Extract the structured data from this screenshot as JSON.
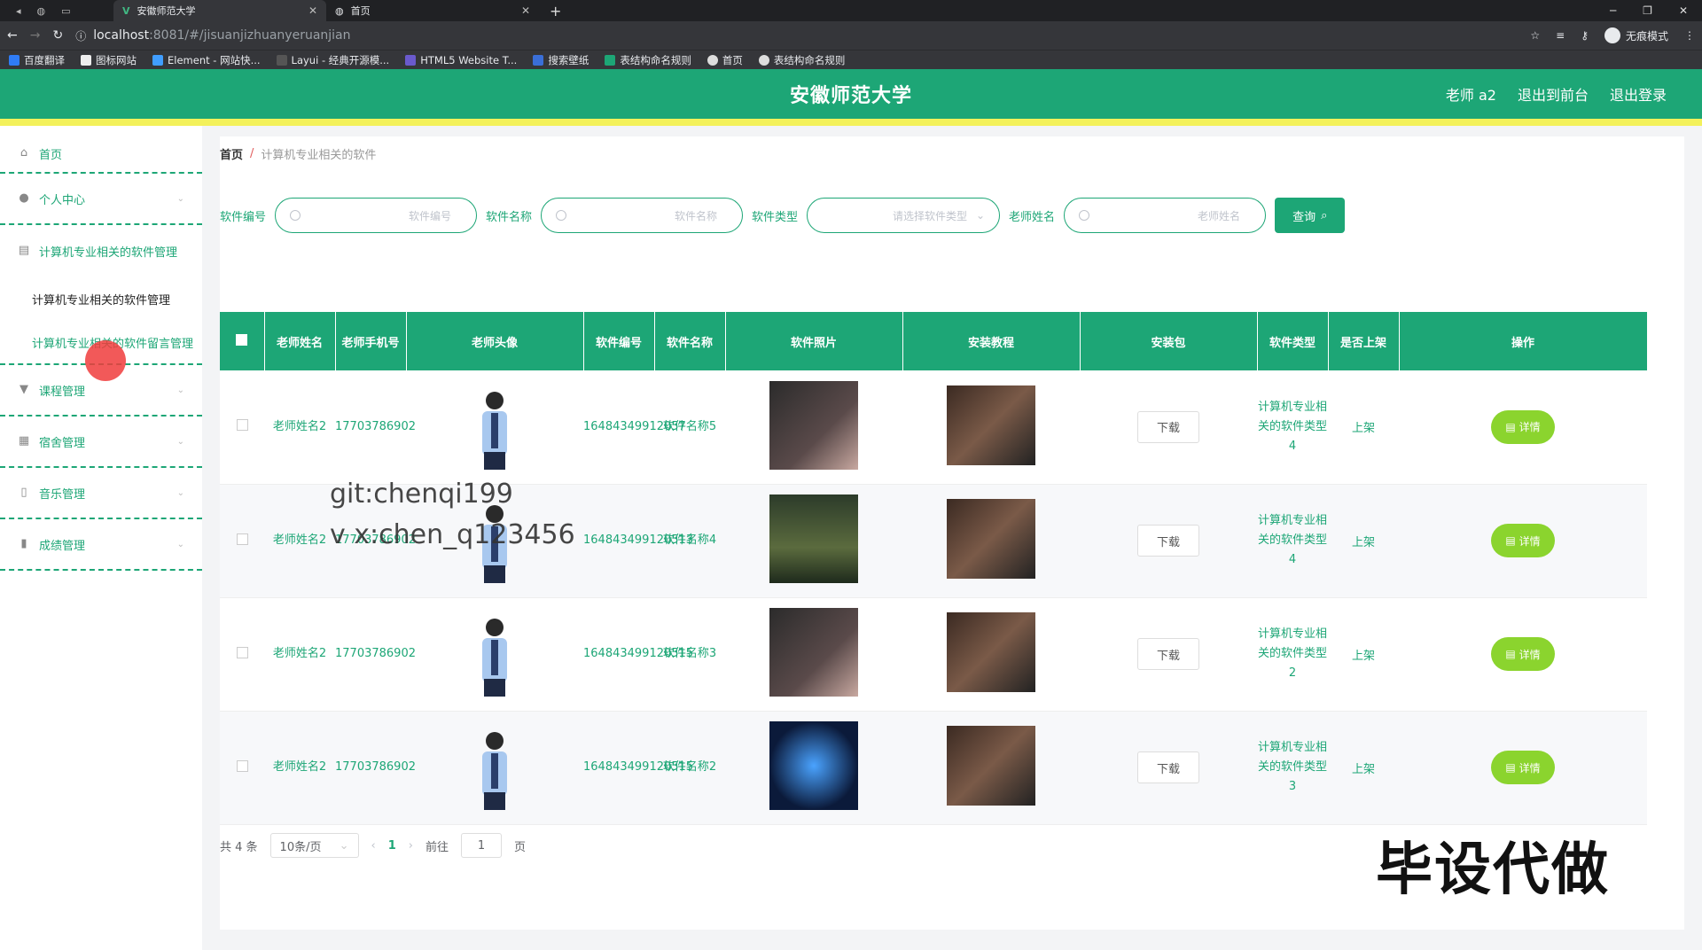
{
  "browser": {
    "tabs": [
      {
        "title": "安徽师范大学",
        "active": true
      },
      {
        "title": "首页",
        "active": false
      }
    ],
    "url_host": "localhost",
    "url_path": ":8081/#/jisuanjizhuanyeruanjian",
    "incognito_label": "无痕模式",
    "bookmarks": [
      "百度翻译",
      "图标网站",
      "Element - 网站快...",
      "Layui - 经典开源模...",
      "HTML5 Website T...",
      "搜索壁纸",
      "表结构命名规则",
      "首页",
      "表结构命名规则"
    ]
  },
  "header": {
    "title": "安徽师范大学",
    "user": "老师 a2",
    "to_front": "退出到前台",
    "logout": "退出登录"
  },
  "sidebar": {
    "home": "首页",
    "personal": "个人中心",
    "software_mgmt": "计算机专业相关的软件管理",
    "software_sub1": "计算机专业相关的软件管理",
    "software_sub2": "计算机专业相关的软件留言管理",
    "course": "课程管理",
    "dorm": "宿舍管理",
    "music": "音乐管理",
    "grade": "成绩管理"
  },
  "breadcrumb": {
    "home": "首页",
    "sep": "/",
    "current": "计算机专业相关的软件"
  },
  "search": {
    "label_code": "软件编号",
    "ph_code": "软件编号",
    "label_name": "软件名称",
    "ph_name": "软件名称",
    "label_type": "软件类型",
    "ph_type": "请选择软件类型",
    "label_teacher": "老师姓名",
    "ph_teacher": "老师姓名",
    "btn_query": "查询"
  },
  "table": {
    "headers": [
      "老师姓名",
      "老师手机号",
      "老师头像",
      "软件编号",
      "软件名称",
      "软件照片",
      "安装教程",
      "安装包",
      "软件类型",
      "是否上架",
      "操作"
    ],
    "rows": [
      {
        "teacher": "老师姓名2",
        "phone": "17703786902",
        "code": "16484349912057",
        "name": "软件名称5",
        "download": "下载",
        "type": "计算机专业相关的软件类型4",
        "shelf": "上架",
        "action": "详情"
      },
      {
        "teacher": "老师姓名2",
        "phone": "17703786902",
        "code": "164843499120513",
        "name": "软件名称4",
        "download": "下载",
        "type": "计算机专业相关的软件类型4",
        "shelf": "上架",
        "action": "详情"
      },
      {
        "teacher": "老师姓名2",
        "phone": "17703786902",
        "code": "164843499120515",
        "name": "软件名称3",
        "download": "下载",
        "type": "计算机专业相关的软件类型2",
        "shelf": "上架",
        "action": "详情"
      },
      {
        "teacher": "老师姓名2",
        "phone": "17703786902",
        "code": "164843499120515",
        "name": "软件名称2",
        "download": "下载",
        "type": "计算机专业相关的软件类型3",
        "shelf": "上架",
        "action": "详情"
      }
    ]
  },
  "pager": {
    "total": "共 4 条",
    "size": "10条/页",
    "current": "1",
    "goto": "前往",
    "goto_value": "1",
    "page_unit": "页"
  },
  "watermarks": {
    "line1": "git:chenqi199",
    "line2": "v x:chen_q123456",
    "big": "毕设代做"
  },
  "colors": {
    "primary": "#1da676",
    "accent_yellow": "#f3f15b",
    "detail_button": "#8bd42e"
  }
}
